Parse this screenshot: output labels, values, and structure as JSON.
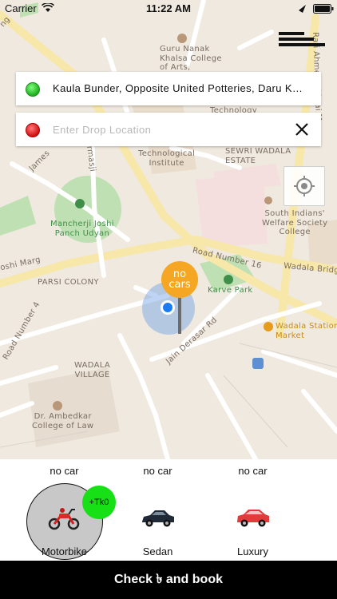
{
  "status_bar": {
    "carrier": "Carrier",
    "time": "11:22 AM"
  },
  "pickup": {
    "address": "Kaula Bunder, Opposite United Potteries, Daru Khana,..."
  },
  "drop": {
    "placeholder": "Enter Drop Location"
  },
  "map": {
    "labels": {
      "guru_nanak": "Guru Nanak\nKhalsa College\nof Arts,",
      "technology": "Technology",
      "tech_institute": "Technological\nInstitute",
      "sewri_wadala": "SEWRI WADALA\nESTATE",
      "south_indians": "South Indians'\nWelfare Society\nCollege",
      "mancherji": "Mancherji Joshi\nPanch Udyan",
      "hormasji": "Hormasji",
      "joshi_marg": "oshi Marg",
      "james": "James",
      "parsi_colony": "PARSI COLONY",
      "road_16": "Road Number 16",
      "wadala_bridge": "Wadala Bridge",
      "karve_park": "Karve Park",
      "wadala_station": "Wadala Station\nMarket",
      "jain_derasar": "Jain Derasar Rd",
      "wadala_village": "WADALA\nVILLAGE",
      "ambedkar": "Dr. Ambedkar\nCollege of Law",
      "road_number_4": "Road Number 4",
      "rafi_ahmed": "Rafi Ahmed Kidwai Marg",
      "ng": "ng"
    }
  },
  "marker": {
    "label": "no cars"
  },
  "vehicles": [
    {
      "status": "no car",
      "name": "Motorbike",
      "fare": "+Tk0",
      "selected": true
    },
    {
      "status": "no car",
      "name": "Sedan",
      "selected": false
    },
    {
      "status": "no car",
      "name": "Luxury",
      "selected": false
    }
  ],
  "book_button": {
    "label": "Check ৳ and book"
  },
  "colors": {
    "accent_green": "#17e017",
    "marker_orange": "#f5a623",
    "location_blue": "#1a7cf5",
    "book_bg": "#000000"
  }
}
